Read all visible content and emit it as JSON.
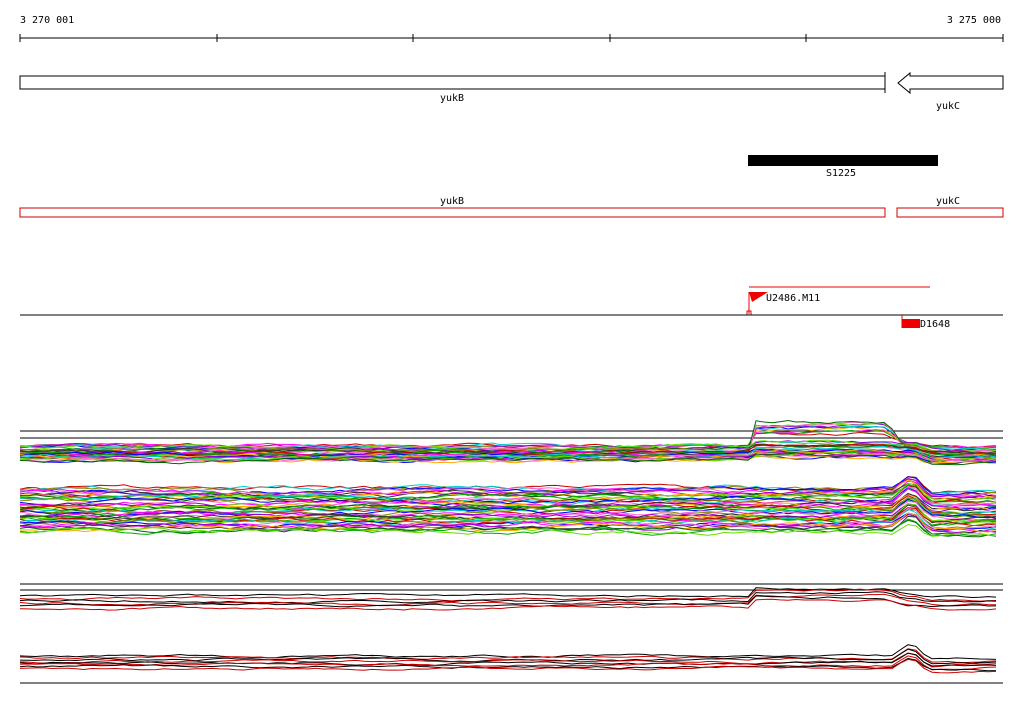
{
  "coordinates": {
    "start_label": "3 270 001",
    "end_label": "3 275 000",
    "start": 3270001,
    "end": 3275000
  },
  "genes": [
    {
      "name": "yukB",
      "strand": "+",
      "start": 3270001,
      "end": 3274400
    },
    {
      "name": "yukC",
      "strand": "-",
      "start": 3274450,
      "end": 3275000
    }
  ],
  "segments": [
    {
      "name": "S1225",
      "start": 3273710,
      "end": 3274680
    }
  ],
  "transcripts": [
    {
      "name": "yukB",
      "start": 3270001,
      "end": 3274400,
      "color": "#cc0000"
    },
    {
      "name": "yukC",
      "start": 3274450,
      "end": 3275000,
      "color": "#cc0000"
    }
  ],
  "upshifts": [
    {
      "name": "U2486.M11",
      "position": 3273710,
      "extent_end": 3274630,
      "color": "#ee0000"
    }
  ],
  "downshifts": [
    {
      "name": "D1648",
      "position": 3274520,
      "color": "#ee0000"
    }
  ],
  "profile_colors": [
    "#cc0000",
    "#ff00ff",
    "#00aa00",
    "#0000ff",
    "#ffaa00",
    "#00cccc",
    "#9900cc",
    "#66dd00",
    "#ff66cc",
    "#006600",
    "#888800",
    "#333333"
  ],
  "summary_colors": [
    "#000000",
    "#cc0000"
  ]
}
